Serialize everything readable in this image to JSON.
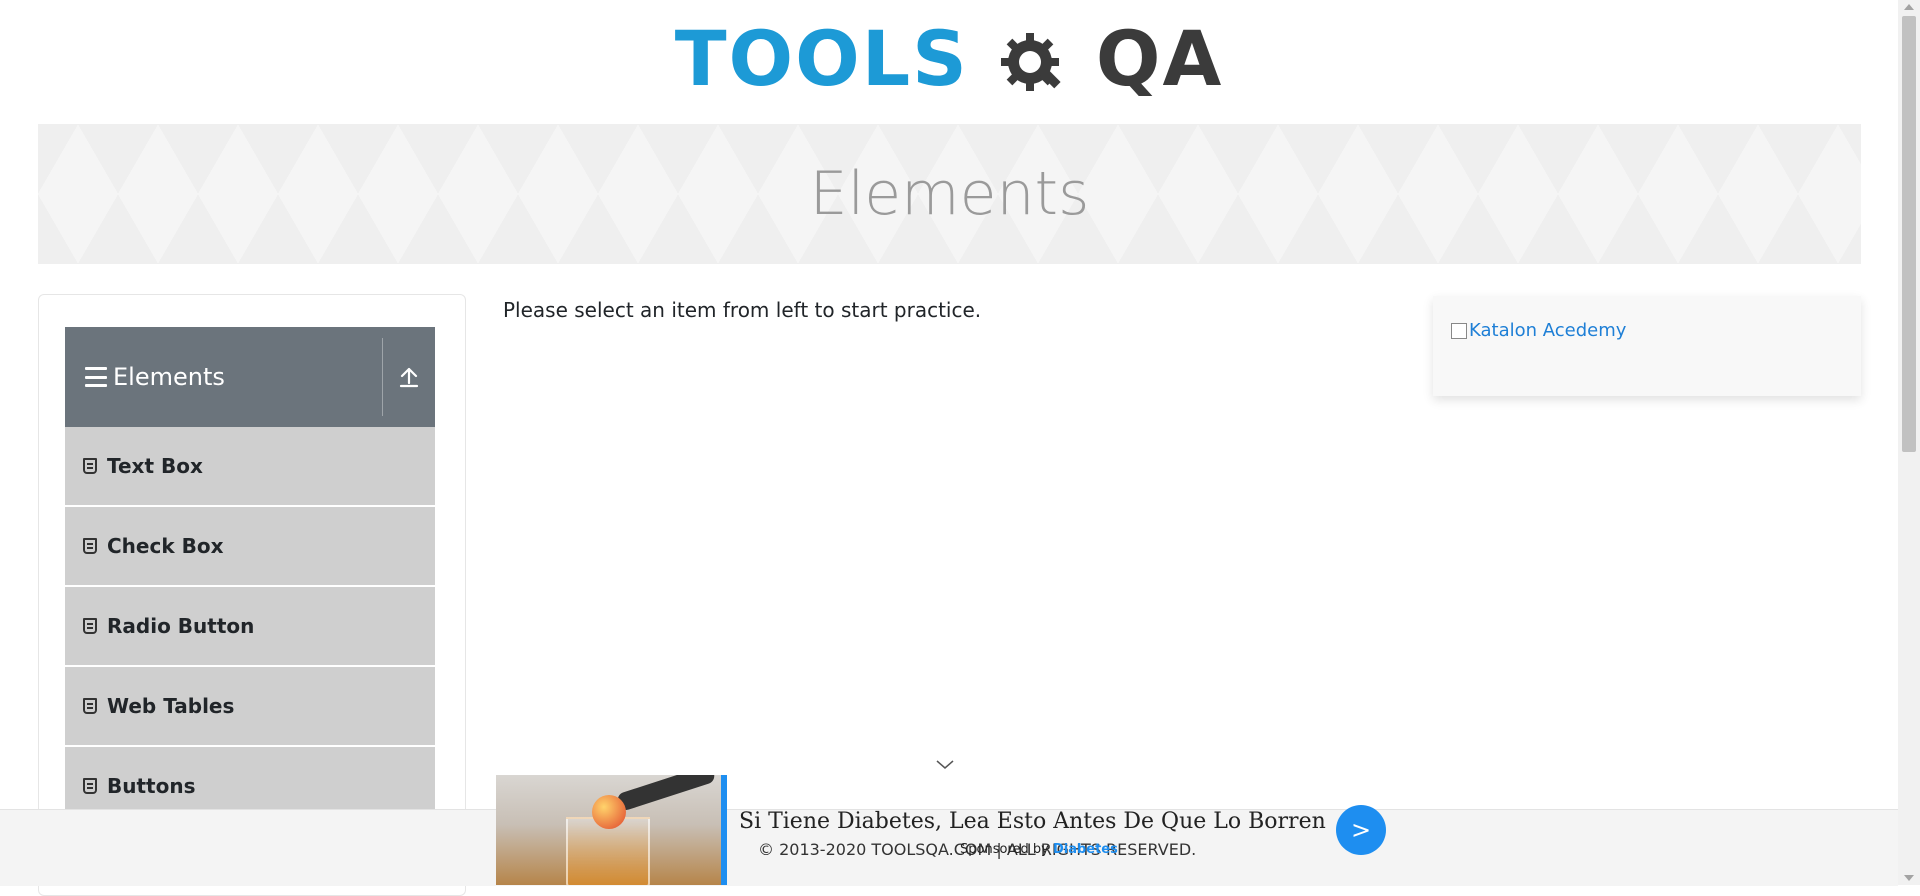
{
  "header": {
    "logo_text_main": "TOOLS",
    "logo_text_accent": "QA"
  },
  "banner": {
    "title": "Elements"
  },
  "sidebar": {
    "group_title": "Elements",
    "items": [
      {
        "label": "Text Box"
      },
      {
        "label": "Check Box"
      },
      {
        "label": "Radio Button"
      },
      {
        "label": "Web Tables"
      },
      {
        "label": "Buttons"
      }
    ]
  },
  "main": {
    "intro": "Please select an item from left to start practice."
  },
  "side_ad": {
    "alt_text": "Katalon Acedemy"
  },
  "footer": {
    "copyright": "© 2013-2020 TOOLSQA.COM | ALL RIGHTS RESERVED."
  },
  "sticky_ad": {
    "headline": "Si Tiene Diabetes, Lea Esto Antes De Que Lo Borren",
    "sponsored_prefix": "Sponsored by",
    "sponsored_brand": "Diabetes",
    "go_label": ">"
  },
  "colors": {
    "brand_blue": "#1d9ad6",
    "logo_dark": "#3b3b3b",
    "group_header": "#6b747c",
    "menu_item": "#cfcfcf",
    "ad_accent": "#1e8ef0"
  },
  "icons": {
    "menu": "hamburger-icon",
    "collapse": "upload-arrow-icon",
    "item": "html5-icon",
    "scroll_hint": "chevron-down-icon"
  }
}
